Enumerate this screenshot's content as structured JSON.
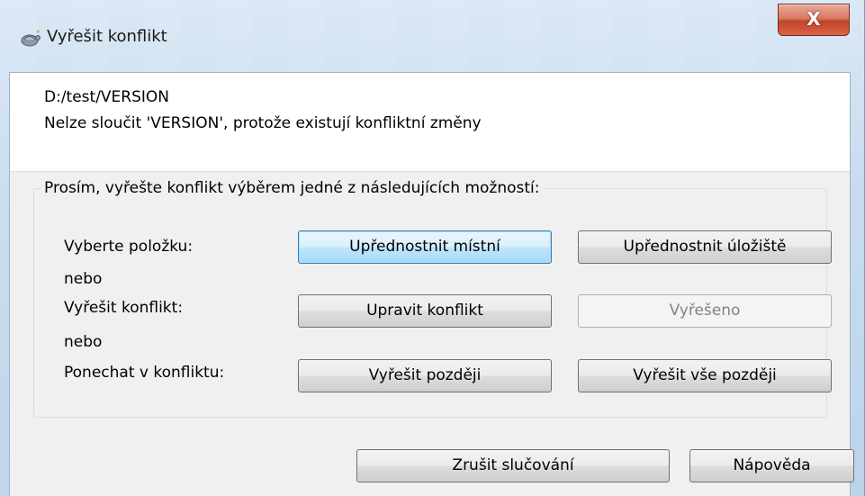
{
  "window": {
    "title": "Vyřešit konflikt",
    "close_glyph": "X",
    "icon": "tortoisegit-icon"
  },
  "info": {
    "path": "D:/test/VERSION",
    "message": "Nelze sloučit 'VERSION', protože existují konfliktní změny"
  },
  "options": {
    "group_title": "Prosím, vyřešte konflikt výběrem jedné z následujících možností:",
    "select_label": "Vyberte položku:",
    "or_label_1": "nebo",
    "resolve_label": "Vyřešit konflikt:",
    "or_label_2": "nebo",
    "leave_label": "Ponechat v konfliktu:",
    "prefer_local": "Upřednostnit místní",
    "prefer_repo": "Upřednostnit úložiště",
    "edit_conflict": "Upravit konflikt",
    "resolved": "Vyřešeno",
    "resolve_later": "Vyřešit později",
    "resolve_all_later": "Vyřešit vše později"
  },
  "footer": {
    "abort_merge": "Zrušit slučování",
    "help": "Nápověda"
  }
}
